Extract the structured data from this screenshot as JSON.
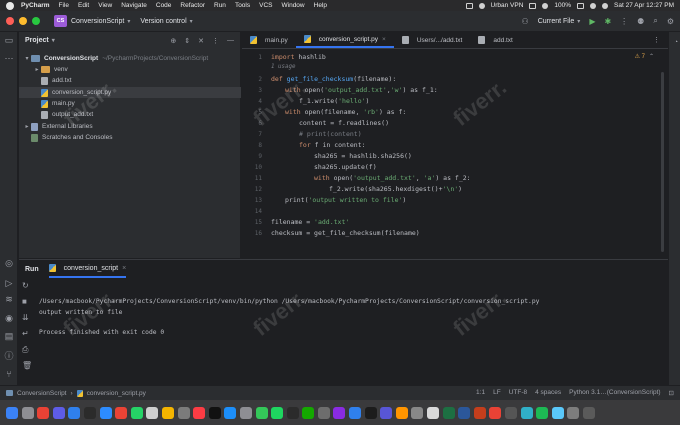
{
  "menubar": {
    "app": "PyCharm",
    "items": [
      "File",
      "Edit",
      "View",
      "Navigate",
      "Code",
      "Refactor",
      "Run",
      "Tools",
      "VCS",
      "Window",
      "Help"
    ],
    "vpn": "Urban VPN",
    "battery": "100%",
    "datetime": "Sat 27 Apr  12:27 PM"
  },
  "titlebar": {
    "project_badge": "CS",
    "project_name": "ConversionScript",
    "vcs": "Version control",
    "run_config": "Current File"
  },
  "project_panel": {
    "title": "Project",
    "tree": [
      {
        "label": "ConversionScript",
        "path": "~/PycharmProjects/ConversionScript",
        "type": "root"
      },
      {
        "label": "venv",
        "type": "venv"
      },
      {
        "label": "add.txt",
        "type": "txt"
      },
      {
        "label": "conversion_script.py",
        "type": "py"
      },
      {
        "label": "main.py",
        "type": "py"
      },
      {
        "label": "output_add.txt",
        "type": "txt"
      },
      {
        "label": "External Libraries",
        "type": "lib"
      },
      {
        "label": "Scratches and Consoles",
        "type": "scr"
      }
    ]
  },
  "editor": {
    "tabs": [
      {
        "label": "main.py"
      },
      {
        "label": "conversion_script.py"
      },
      {
        "label": "Users/.../add.txt"
      },
      {
        "label": "add.txt"
      }
    ],
    "inspection": "⚠ 7",
    "line_numbers": [
      "1",
      "2",
      "3",
      "4",
      "5",
      "6",
      "7",
      "8",
      "9",
      "10",
      "11",
      "12",
      "13",
      "14",
      "15",
      "16"
    ],
    "code": {
      "l1_kw": "import",
      "l1_rest": " hashlib",
      "usage": "1 usage",
      "l2_kw": "def",
      "l2_fn": "get_file_checksum",
      "l2_rest": "(filename):",
      "l3_kw": "with",
      "l3_a": " open(",
      "l3_s1": "'output_add.txt'",
      "l3_c": ",",
      "l3_s2": "'w'",
      "l3_d": ") as f_1:",
      "l4_a": "f_1.write(",
      "l4_s": "'hello'",
      "l4_b": ")",
      "l5_kw": "with",
      "l5_a": " open(filename, ",
      "l5_s": "'rb'",
      "l5_b": ") as f:",
      "l6": "content = f.readlines()",
      "l7": "# print(content)",
      "l8_kw": "for",
      "l8_rest": " f in content:",
      "l9": "sha265 = hashlib.sha256()",
      "l10": "sha265.update(f)",
      "l11_kw": "with",
      "l11_a": " open(",
      "l11_s1": "'output_add.txt'",
      "l11_c": ", ",
      "l11_s2": "'a'",
      "l11_d": ") as f_2:",
      "l12_a": "f_2.write(sha265.hexdigest()+",
      "l12_s": "'\\n'",
      "l12_b": ")",
      "l13_a": "print(",
      "l13_s": "'output written to file'",
      "l13_b": ")",
      "l15_a": "filename = ",
      "l15_s": "'add.txt'",
      "l16": "checksum = get_file_checksum(filename)"
    }
  },
  "run_panel": {
    "title": "Run",
    "tab": "conversion_script",
    "lines": [
      "/Users/macbook/PycharmProjects/ConversionScript/venv/bin/python /Users/macbook/PycharmProjects/ConversionScript/conversion_script.py",
      "output written to file",
      "",
      "Process finished with exit code 0"
    ]
  },
  "statusbar": {
    "crumb1": "ConversionScript",
    "crumb2": "conversion_script.py",
    "position": "1:1",
    "line_sep": "LF",
    "encoding": "UTF-8",
    "indent": "4 spaces",
    "interpreter": "Python 3.1…(ConversionScript)"
  },
  "watermark": "fiverr.",
  "colors": {
    "accent": "#3574f0",
    "keyword": "#cf8e6d",
    "string": "#6aab73",
    "function": "#56a8f5"
  }
}
